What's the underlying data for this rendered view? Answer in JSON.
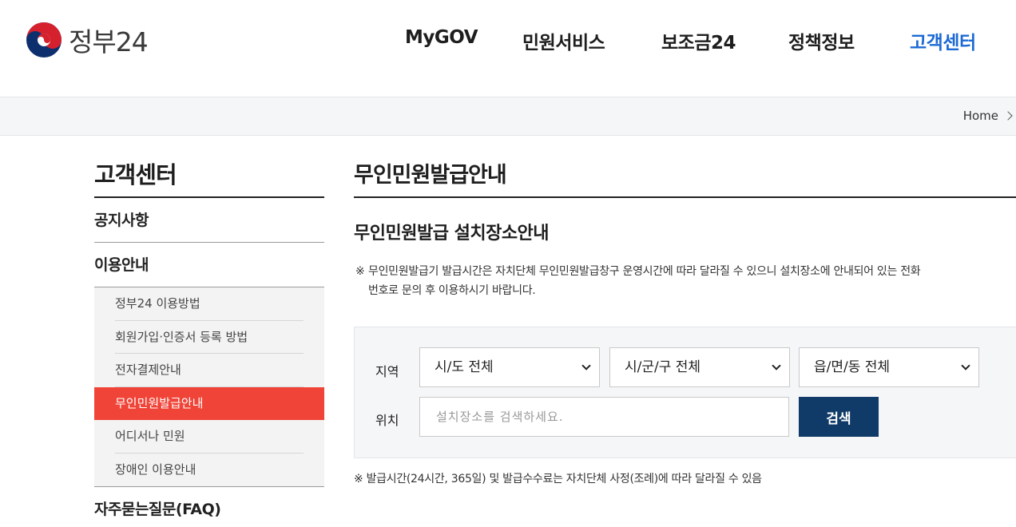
{
  "header": {
    "logo_text": "정부24",
    "nav": [
      "MyGOV",
      "민원서비스",
      "보조금24",
      "정책정보",
      "고객센터"
    ],
    "accent_color": "#1d6ad4"
  },
  "breadcrumb": {
    "home": "Home",
    "icon": "chevron-right-icon"
  },
  "sidebar": {
    "title": "고객센터",
    "items": [
      {
        "label": "공지사항"
      },
      {
        "label": "이용안내"
      }
    ],
    "sub_items": [
      "정부24 이용방법",
      "회원가입·인증서 등록 방법",
      "전자결제안내",
      "무인민원발급안내",
      "어디서나 민원",
      "장애인 이용안내"
    ],
    "active_sub": "무인민원발급안내",
    "active_color": "#f04438",
    "faq": "자주묻는질문(FAQ)"
  },
  "main": {
    "title": "무인민원발급안내",
    "section_title": "무인민원발급 설치장소안내",
    "notice_mark": "※",
    "notice": "무인민원발급기 발급시간은 자치단체 무인민원발급창구 운영시간에 따라 달라질 수 있으니 설치장소에 안내되어 있는 전화번호로 문의 후 이용하시기 바랍니다.",
    "search": {
      "region_label": "지역",
      "select_sido": "시/도 전체",
      "select_sigungu": "시/군/구 전체",
      "select_emd": "읍/면/동 전체",
      "location_label": "위치",
      "location_placeholder": "설치장소를 검색하세요.",
      "location_value": "",
      "button": "검색",
      "button_color": "#103a67"
    },
    "footnote": "※ 발급시간(24시간, 365일) 및 발급수수료는 자치단체 사정(조례)에 따라 달라질 수 있음"
  }
}
